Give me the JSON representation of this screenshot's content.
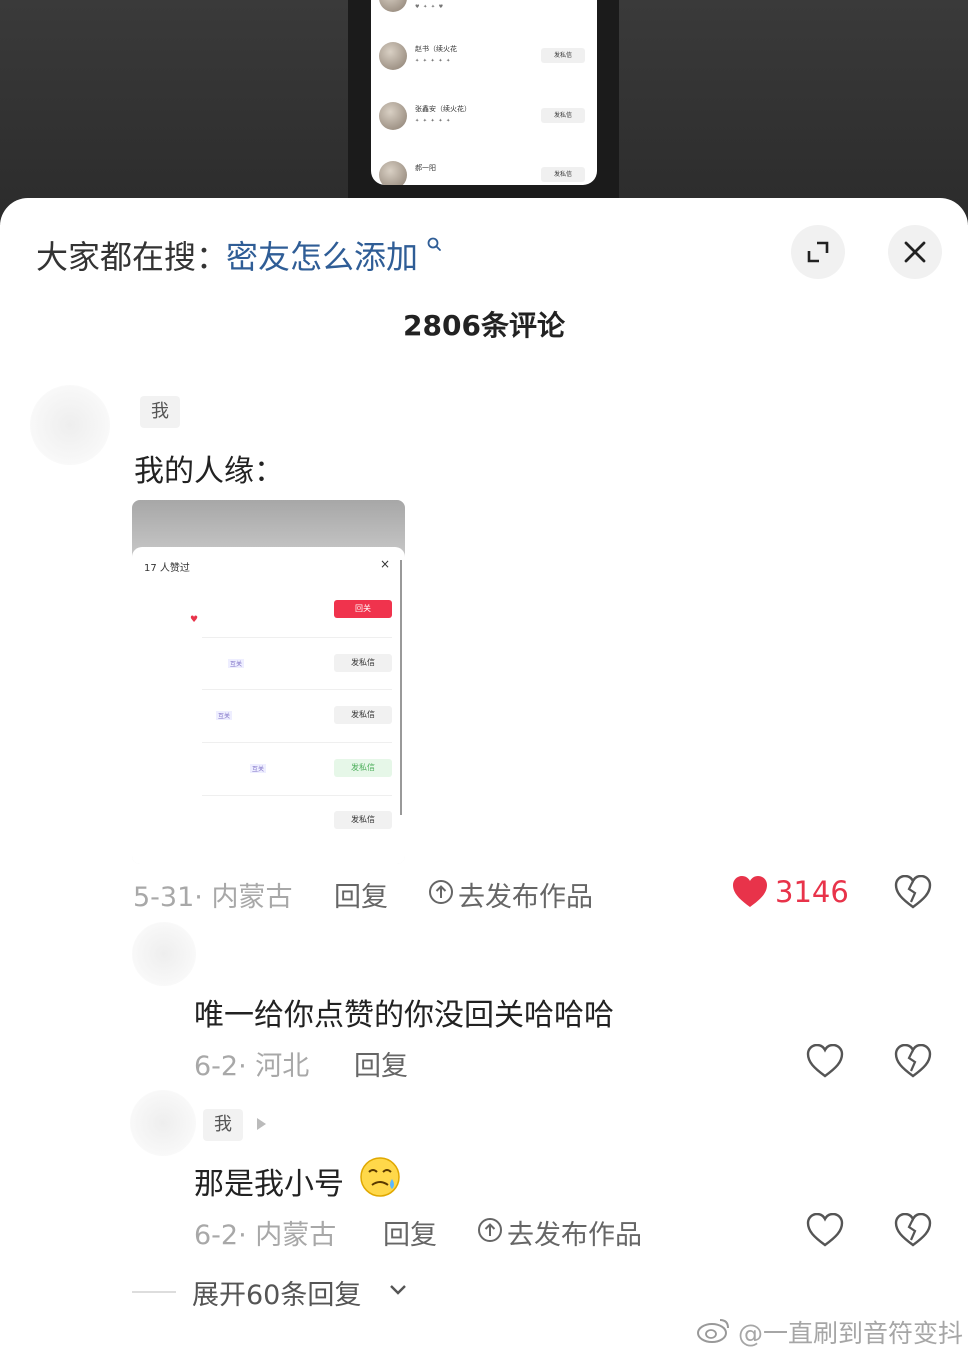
{
  "preview": {
    "rows": [
      {
        "name": "",
        "stats": "",
        "button": ""
      },
      {
        "name": "赵书（续火花",
        "stats": "",
        "button": "发私信"
      },
      {
        "name": "张鑫安（续火花）",
        "stats": "",
        "button": "发私信"
      },
      {
        "name": "郝一阳",
        "stats": "",
        "button": "发私信"
      }
    ]
  },
  "header": {
    "search_prefix": "大家都在搜：",
    "search_term": "密友怎么添加",
    "comment_count": "2806条评论"
  },
  "comments": [
    {
      "tag": "我",
      "text": "我的人缘：",
      "meta": "5-31· 内蒙古",
      "reply_label": "回复",
      "publish_label": "去发布作品",
      "likes": "3146",
      "attachment": {
        "title": "17 人赞过",
        "close": "×",
        "rows": [
          {
            "button": "回关",
            "chip": ""
          },
          {
            "button": "发私信",
            "chip": "互关"
          },
          {
            "button": "发私信",
            "chip": "互关"
          },
          {
            "button": "发私信",
            "chip": "互关"
          },
          {
            "button": "发私信",
            "chip": ""
          }
        ]
      }
    }
  ],
  "replies": [
    {
      "tag": "",
      "text": "唯一给你点赞的你没回关哈哈哈",
      "meta": "6-2· 河北",
      "reply_label": "回复",
      "publish_label": ""
    },
    {
      "tag": "我",
      "text": "那是我小号",
      "meta": "6-2· 内蒙古",
      "reply_label": "回复",
      "publish_label": "去发布作品"
    }
  ],
  "expand_label": "展开60条回复",
  "watermark": "@一直刷到音符变抖",
  "colors": {
    "accent_like": "#e8334a",
    "link": "#2f5d96",
    "meta_gray": "#a8a8a8"
  }
}
